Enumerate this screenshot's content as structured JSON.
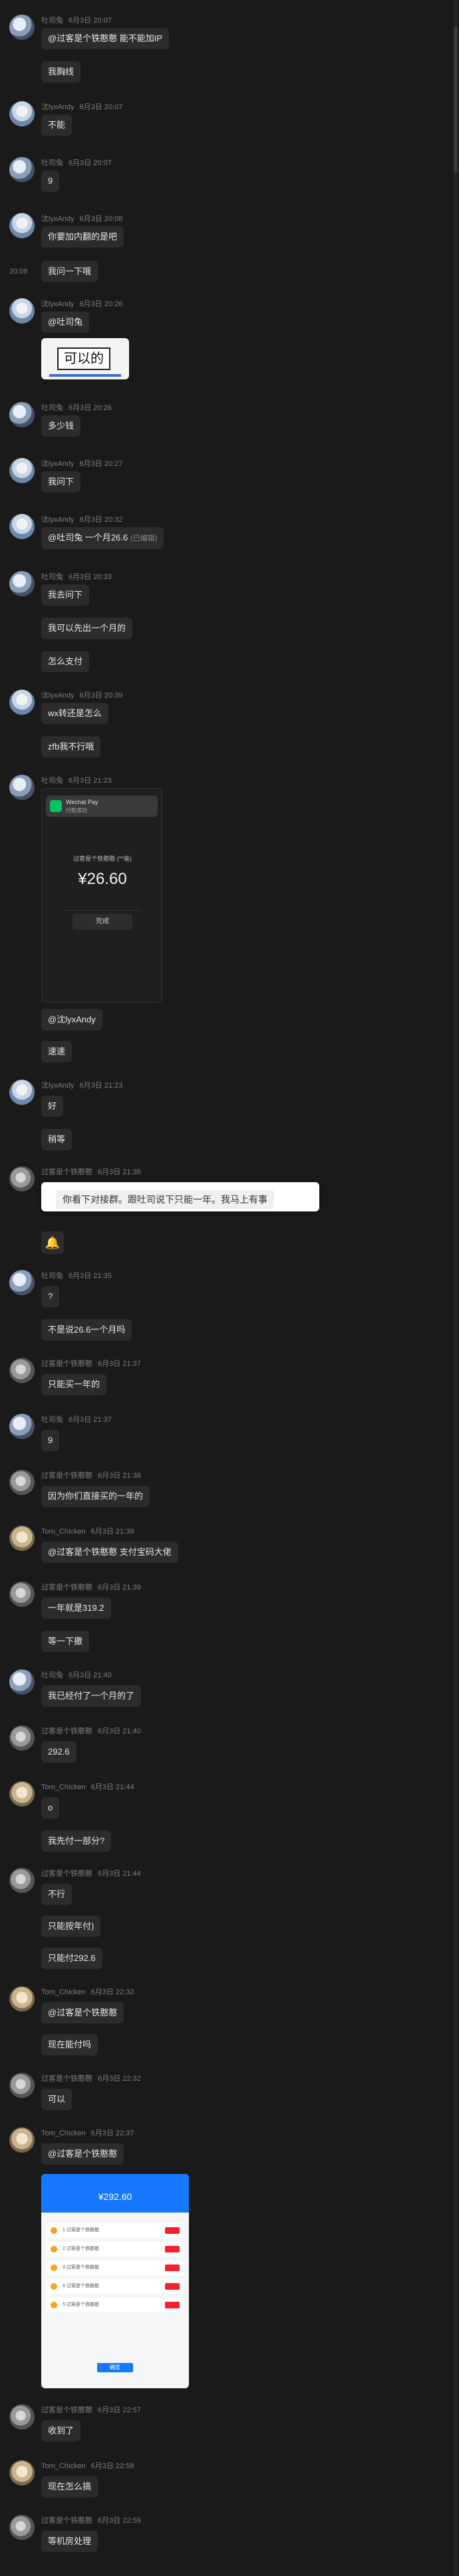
{
  "messages": [
    {
      "sender": "吐司兔",
      "time": "6月3日 20:07",
      "text": "@过客是个铁憨憨 能不能加IP"
    },
    {
      "text": "我胸线"
    },
    {
      "sender": "沈lyxAndy",
      "time": "6月3日 20:07",
      "text": "不能"
    },
    {
      "sender": "吐司兔",
      "time": "6月3日 20:07",
      "text": "9"
    },
    {
      "sender": "沈lyxAndy",
      "time": "6月3日 20:08",
      "text": "你要加内翻的是吧"
    },
    {
      "side_time": "20:08",
      "text": "我问一下哦"
    },
    {
      "sender": "沈lyxAndy",
      "time": "6月3日 20:26",
      "text": "@吐司兔"
    },
    {
      "image_caption": "可以的"
    },
    {
      "sender": "吐司兔",
      "time": "6月3日 20:26",
      "text": "多少钱"
    },
    {
      "sender": "沈lyxAndy",
      "time": "6月3日 20:27",
      "text": "我问下"
    },
    {
      "sender": "沈lyxAndy",
      "time": "6月3日 20:32",
      "text": "@吐司兔 一个月26.6",
      "edited": "(已编辑)"
    },
    {
      "sender": "吐司兔",
      "time": "6月3日 20:33",
      "text": "我去问下"
    },
    {
      "text": "我可以先出一个月的"
    },
    {
      "text": "怎么支付"
    },
    {
      "sender": "沈lyxAndy",
      "time": "6月3日 20:39",
      "text": "wx转还是怎么"
    },
    {
      "text": "zfb我不行哦"
    },
    {
      "sender": "吐司兔",
      "time": "6月3日 21:23"
    },
    {
      "text": "@沈lyxAndy"
    },
    {
      "text": "速速"
    },
    {
      "sender": "沈lyxAndy",
      "time": "6月3日 21:23",
      "text": "好"
    },
    {
      "text": "稍等"
    },
    {
      "sender": "过客是个铁憨憨",
      "time": "6月3日 21:35",
      "toast": "你看下对接群。跟吐司说下只能一年。我马上有事"
    },
    {
      "bell": "🔔"
    },
    {
      "sender": "吐司兔",
      "time": "6月3日 21:35",
      "text": "?"
    },
    {
      "text": "不是说26.6一个月吗"
    },
    {
      "sender": "过客是个铁憨憨",
      "time": "6月3日 21:37",
      "text": "只能买一年的"
    },
    {
      "sender": "吐司兔",
      "time": "6月3日 21:37",
      "text": "9"
    },
    {
      "sender": "过客是个铁憨憨",
      "time": "6月3日 21:38",
      "text": "因为你们直接买的一年的"
    },
    {
      "sender": "Tom_Chicken",
      "time": "6月3日 21:39",
      "text": "@过客是个铁憨憨 支付宝码大佬"
    },
    {
      "sender": "过客是个铁憨憨",
      "time": "6月3日 21:39",
      "text": "一年就是319.2"
    },
    {
      "text": "等一下撒"
    },
    {
      "sender": "吐司兔",
      "time": "6月3日 21:40",
      "text": "我已经付了一个月的了"
    },
    {
      "sender": "过客是个铁憨憨",
      "time": "6月3日 21:40",
      "text": "292.6"
    },
    {
      "sender": "Tom_Chicken",
      "time": "6月3日 21:44",
      "text": "o"
    },
    {
      "text": "我先付一部分?"
    },
    {
      "sender": "过客是个铁憨憨",
      "time": "6月3日 21:44",
      "text": "不行"
    },
    {
      "text": "只能按年付)"
    },
    {
      "text": "只能付292.6"
    },
    {
      "sender": "Tom_Chicken",
      "time": "6月3日 22:32",
      "text": "@过客是个铁憨憨"
    },
    {
      "text": "现在能付吗"
    },
    {
      "sender": "过客是个铁憨憨",
      "time": "6月3日 22:32",
      "text": "可以"
    },
    {
      "sender": "Tom_Chicken",
      "time": "6月3日 22:37",
      "text": "@过客是个铁憨憨"
    },
    {
      "sender": "过客是个铁憨憨",
      "time": "6月3日 22:57",
      "text": "收到了"
    },
    {
      "sender": "Tom_Chicken",
      "time": "6月3日 22:58",
      "text": "现在怎么搞"
    },
    {
      "sender": "过客是个铁憨憨",
      "time": "6月3日 22:59",
      "text": "等机房处理"
    }
  ],
  "payment_screenshot": {
    "notif_title": "Wechat Pay",
    "notif_sub": "付款成功",
    "payee": "过客是个铁憨憨 (**毫)",
    "amount": "¥26.60",
    "button": "完成"
  },
  "payment_screenshot_2": {
    "amount": "¥292.60",
    "rows": [
      "1 过客是个铁憨憨",
      "2 过客是个铁憨憨",
      "3 过客是个铁憨憨",
      "4 过客是个铁憨憨",
      "5 过客是个铁憨憨"
    ],
    "button": "确定"
  },
  "colors": {
    "background": "#1a1a1a",
    "bubble": "#2c2c2c",
    "meta": "#7d7d7d",
    "accent_pay": "#07c160",
    "accent_blue": "#1677ff"
  }
}
